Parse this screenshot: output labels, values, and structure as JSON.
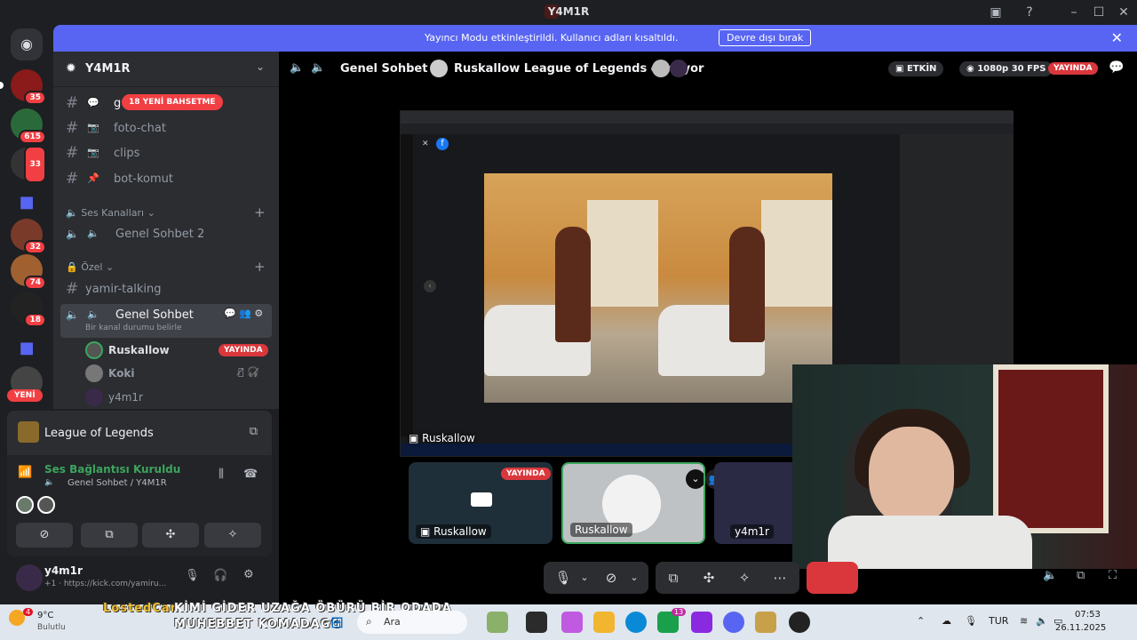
{
  "window": {
    "title": "Y4M1R"
  },
  "banner": {
    "message": "Yayıncı Modu etkinleştirildi. Kullanıcı adları kısaltıldı.",
    "button": "Devre dışı bırak"
  },
  "rail": {
    "badges": [
      "35",
      "615",
      "33",
      "32",
      "74",
      "18"
    ],
    "new_label": "YENİ"
  },
  "server": {
    "name": "Y4M1R"
  },
  "sidebar": {
    "mention_pill": "18 YENİ BAHSETME",
    "text_channels": [
      {
        "name": "g"
      },
      {
        "name": "foto-chat"
      },
      {
        "name": "clips"
      },
      {
        "name": "bot-komut"
      }
    ],
    "voice_category": "Ses Kanalları",
    "voice_channel_2": "Genel Sohbet 2",
    "private_category": "Özel",
    "yamir_talking": "yamir-talking",
    "active_channel": "Genel Sohbet",
    "channel_status": "Bir kanal durumu belirle",
    "voice_users": [
      {
        "name": "Ruskallow",
        "badge": "YAYINDA"
      },
      {
        "name": "Koki"
      },
      {
        "name": "y4m1r"
      }
    ]
  },
  "activity": {
    "title": "League of Legends"
  },
  "voice_status": {
    "title": "Ses Bağlantısı Kuruldu",
    "subtitle": "Genel Sohbet / Y4M1R"
  },
  "user": {
    "name": "y4m1r",
    "status": "+1 · https://kick.com/yamiru..."
  },
  "stage": {
    "channel": "Genel Sohbet",
    "activity": "Ruskallow League of Legends oynuyor",
    "active_pill": "ETKİN",
    "quality_pill": "1080p 30 FPS",
    "live_pill": "YAYINDA",
    "stream_owner": "Ruskallow",
    "thumbs": [
      {
        "label": "Ruskallow",
        "badge": "YAYINDA"
      },
      {
        "label": "Ruskallow"
      },
      {
        "label": "y4m1r"
      }
    ]
  },
  "taskbar": {
    "temperature": "9°C",
    "weather": "Bulutlu",
    "overlay_user": "LostedCan",
    "overlay_line1": "KİMİ GİDER UZAĞA ÖBÜRÜ BİR ODADA",
    "overlay_line2": "MUHEBBET KOMADAGG",
    "search": "Ara",
    "weather_badge": "4",
    "store_badge": "13",
    "lang": "TUR",
    "time": "07:53",
    "date": "26.11.2025"
  },
  "colors": {
    "blurple": "#5865f2",
    "live_red": "#da373c",
    "green": "#3ba55d"
  }
}
